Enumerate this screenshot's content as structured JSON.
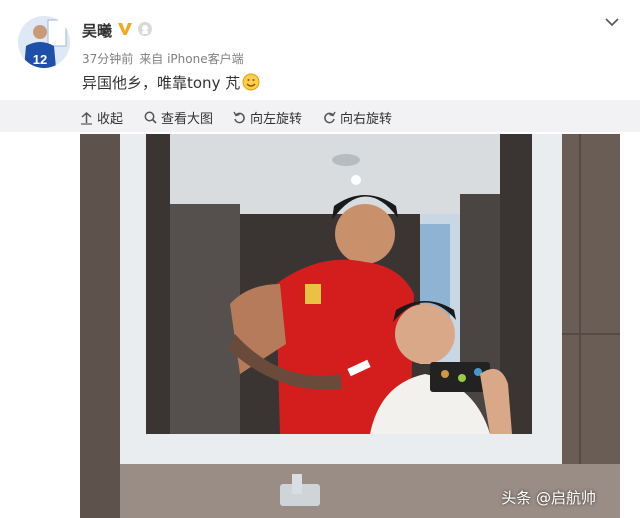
{
  "post": {
    "username": "吴曦",
    "time": "37分钟前",
    "source": "来自 iPhone客户端",
    "text": "异国他乡，唯靠tony 芃",
    "avatar_jersey_number": "12"
  },
  "toolbar": {
    "collapse": "收起",
    "view_large": "查看大图",
    "rotate_left": "向左旋转",
    "rotate_right": "向右旋转"
  },
  "photo": {
    "watermark": "头条 @启航帅"
  },
  "icons": [
    "verified-v-icon",
    "member-badge-icon",
    "chevron-down-icon",
    "collapse-arrow-icon",
    "magnifier-icon",
    "rotate-left-icon",
    "rotate-right-icon",
    "emoji-icon"
  ],
  "colors": {
    "verified": "#f5a623",
    "toolbar_bg": "#f2f2f5",
    "text": "#333333",
    "meta": "#808080"
  }
}
